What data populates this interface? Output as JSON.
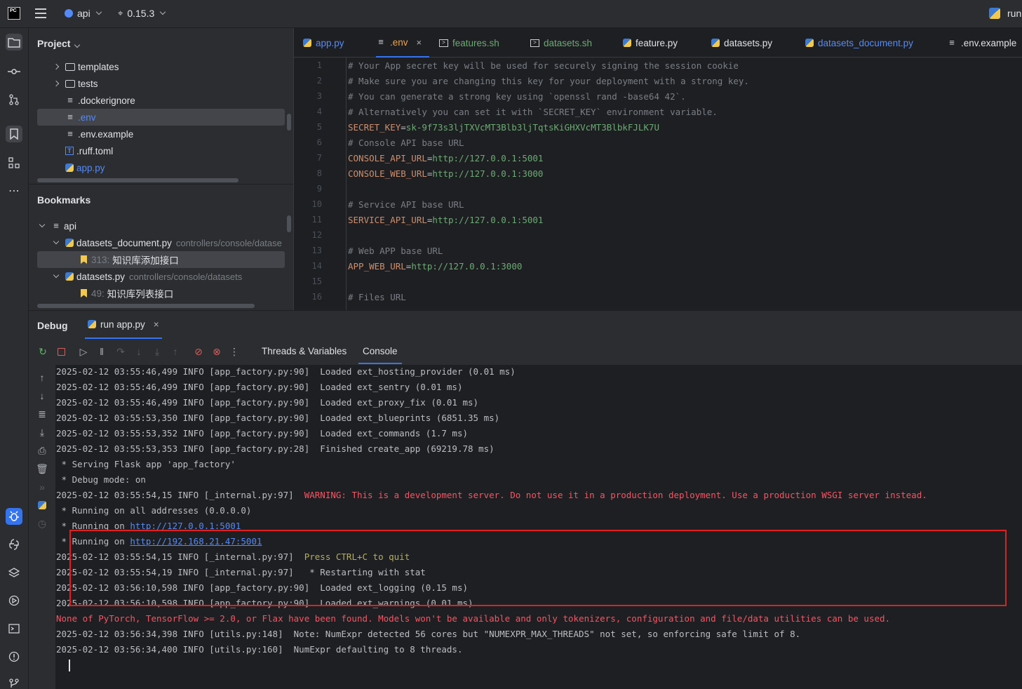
{
  "topbar": {
    "logo_text": "PC",
    "project_name": "api",
    "branch": "0.15.3",
    "run_label": "run"
  },
  "project_panel": {
    "title": "Project",
    "items": [
      {
        "label": "templates"
      },
      {
        "label": "tests"
      },
      {
        "label": ".dockerignore"
      },
      {
        "label": ".env"
      },
      {
        "label": ".env.example"
      },
      {
        "label": ".ruff.toml"
      },
      {
        "label": "app.py"
      }
    ]
  },
  "bookmarks_panel": {
    "title": "Bookmarks",
    "root": "api",
    "groups": [
      {
        "file": "datasets_document.py",
        "path": "controllers/console/datase",
        "bookmark_line": "313:",
        "bookmark_label": "知识库添加接口"
      },
      {
        "file": "datasets.py",
        "path": "controllers/console/datasets",
        "bookmark_line": "49:",
        "bookmark_label": "知识库列表接口"
      }
    ]
  },
  "editor": {
    "tabs": [
      {
        "label": "app.py"
      },
      {
        "label": ".env"
      },
      {
        "label": "features.sh"
      },
      {
        "label": "datasets.sh"
      },
      {
        "label": "feature.py"
      },
      {
        "label": "datasets.py"
      },
      {
        "label": "datasets_document.py"
      },
      {
        "label": ".env.example"
      }
    ],
    "line_numbers": [
      "1",
      "2",
      "3",
      "4",
      "5",
      "6",
      "7",
      "8",
      "9",
      "10",
      "11",
      "12",
      "13",
      "14",
      "15",
      "16"
    ],
    "lines": [
      {
        "comment": "# Your App secret key will be used for securely signing the session cookie"
      },
      {
        "comment": "# Make sure you are changing this key for your deployment with a strong key."
      },
      {
        "comment": "# You can generate a strong key using `openssl rand -base64 42`."
      },
      {
        "comment": "# Alternatively you can set it with `SECRET_KEY` environment variable."
      },
      {
        "key": "SECRET_KEY",
        "value": "sk-9f73s3ljTXVcMT3Blb3ljTqtsKiGHXVcMT3BlbkFJLK7U"
      },
      {
        "comment": "# Console API base URL"
      },
      {
        "key": "CONSOLE_API_URL",
        "value": "http://127.0.0.1:5001"
      },
      {
        "key": "CONSOLE_WEB_URL",
        "value": "http://127.0.0.1:3000"
      },
      {
        "comment": ""
      },
      {
        "comment": "# Service API base URL"
      },
      {
        "key": "SERVICE_API_URL",
        "value": "http://127.0.0.1:5001"
      },
      {
        "comment": ""
      },
      {
        "comment": "# Web APP base URL"
      },
      {
        "key": "APP_WEB_URL",
        "value": "http://127.0.0.1:3000"
      },
      {
        "comment": ""
      },
      {
        "comment": "# Files URL"
      }
    ]
  },
  "debug": {
    "title": "Debug",
    "session_tab": "run app.py",
    "subtabs": [
      "Threads & Variables",
      "Console"
    ],
    "console_lines": [
      {
        "text": "2025-02-12 03:55:46,499 INFO [app_factory.py:90]  Loaded ext_hosting_provider (0.01 ms)"
      },
      {
        "text": "2025-02-12 03:55:46,499 INFO [app_factory.py:90]  Loaded ext_sentry (0.01 ms)"
      },
      {
        "text": "2025-02-12 03:55:46,499 INFO [app_factory.py:90]  Loaded ext_proxy_fix (0.01 ms)"
      },
      {
        "text": "2025-02-12 03:55:53,350 INFO [app_factory.py:90]  Loaded ext_blueprints (6851.35 ms)"
      },
      {
        "text": "2025-02-12 03:55:53,352 INFO [app_factory.py:90]  Loaded ext_commands (1.7 ms)"
      },
      {
        "text": "2025-02-12 03:55:53,353 INFO [app_factory.py:28]  Finished create_app (69219.78 ms)"
      },
      {
        "text": " * Serving Flask app 'app_factory'"
      },
      {
        "text": " * Debug mode: on"
      },
      {
        "prefix": "2025-02-12 03:55:54,15 INFO [_internal.py:97]  ",
        "red": "WARNING: This is a development server. Do not use it in a production deployment. Use a production WSGI server instead."
      },
      {
        "text": " * Running on all addresses (0.0.0.0)"
      },
      {
        "prefix": " * Running on ",
        "link": "http://127.0.0.1:5001"
      },
      {
        "prefix": " * Running on ",
        "link": "http://192.168.21.47:5001"
      },
      {
        "prefix": "2025-02-12 03:55:54,15 INFO [_internal.py:97]  ",
        "yellow": "Press CTRL+C to quit"
      },
      {
        "text": "2025-02-12 03:55:54,19 INFO [_internal.py:97]   * Restarting with stat"
      },
      {
        "text": "2025-02-12 03:56:10,598 INFO [app_factory.py:90]  Loaded ext_logging (0.15 ms)"
      },
      {
        "text": "2025-02-12 03:56:10,598 INFO [app_factory.py:90]  Loaded ext_warnings (0.01 ms)"
      },
      {
        "red": "None of PyTorch, TensorFlow >= 2.0, or Flax have been found. Models won't be available and only tokenizers, configuration and file/data utilities can be used."
      },
      {
        "text": "2025-02-12 03:56:34,398 INFO [utils.py:148]  Note: NumExpr detected 56 cores but \"NUMEXPR_MAX_THREADS\" not set, so enforcing safe limit of 8."
      },
      {
        "text": "2025-02-12 03:56:34,400 INFO [utils.py:160]  NumExpr defaulting to 8 threads."
      }
    ]
  },
  "colors": {
    "accent": "#3574f0",
    "highlight_box": "#e02020",
    "warning_red": "#f75464",
    "key_orange": "#cf8e6d",
    "value_green": "#6aab73"
  }
}
